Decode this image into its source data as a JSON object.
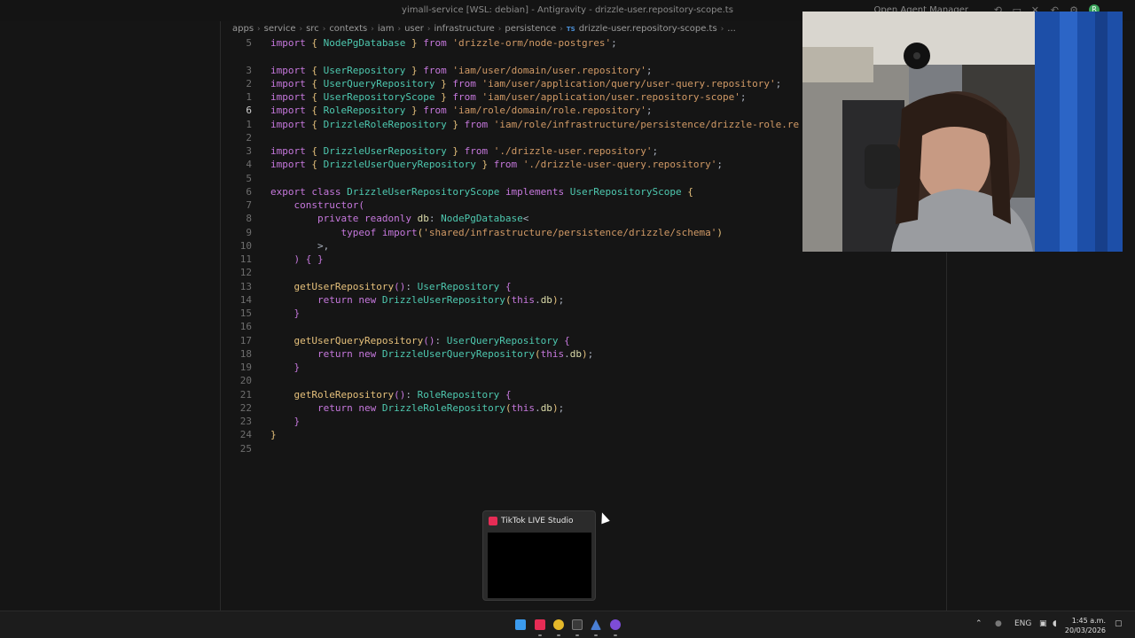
{
  "window": {
    "title": "yimall-service [WSL: debian] - Antigravity - drizzle-user.repository-scope.ts",
    "agent_manager": "Open Agent Manager",
    "avatar_initial": "R"
  },
  "breadcrumb": {
    "items": [
      "apps",
      "service",
      "src",
      "contexts",
      "iam",
      "user",
      "infrastructure",
      "persistence"
    ],
    "file_badge": "TS",
    "file": "drizzle-user.repository-scope.ts",
    "more": "..."
  },
  "editor": {
    "line_numbers": [
      "5",
      "",
      "3",
      "2",
      "1",
      "6",
      "1",
      "2",
      "3",
      "4",
      "5",
      "6",
      "7",
      "8",
      "9",
      "10",
      "11",
      "12",
      "13",
      "14",
      "15",
      "16",
      "17",
      "18",
      "19",
      "20",
      "21",
      "22",
      "23",
      "24",
      "25"
    ],
    "active_line": "6"
  },
  "popup": {
    "title": "TikTok LIVE Studio"
  },
  "taskbar": {
    "language": "ENG",
    "time": "1:45 a.m.",
    "date": "20/03/2026",
    "icons": [
      "windows-start-icon",
      "tiktok-icon",
      "chrome-icon",
      "terminal-icon",
      "antigravity-icon",
      "obs-icon"
    ]
  },
  "colors": {
    "keyword": "#c678dd",
    "type": "#4ec9b0",
    "string": "#d19a66",
    "function": "#e5c07b",
    "accent_tiktok": "#e62c55"
  }
}
